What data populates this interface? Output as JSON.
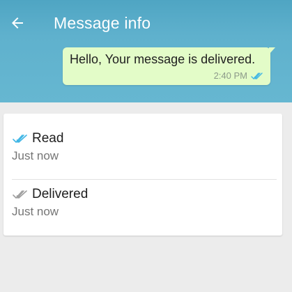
{
  "header": {
    "title": "Message info",
    "back_icon": "arrow-left-icon"
  },
  "message": {
    "text": "Hello, Your message is delivered.",
    "time": "2:40 PM",
    "status_icon": "double-check-icon"
  },
  "receipts": {
    "read": {
      "label": "Read",
      "time": "Just now",
      "icon": "double-check-icon"
    },
    "delivered": {
      "label": "Delivered",
      "time": "Just now",
      "icon": "double-check-icon"
    }
  },
  "colors": {
    "header": "#5fb1cd",
    "bubble": "#e3fcc8",
    "read_check": "#3eb5e5",
    "delivered_check": "#9e9e9e",
    "background": "#ececec"
  }
}
